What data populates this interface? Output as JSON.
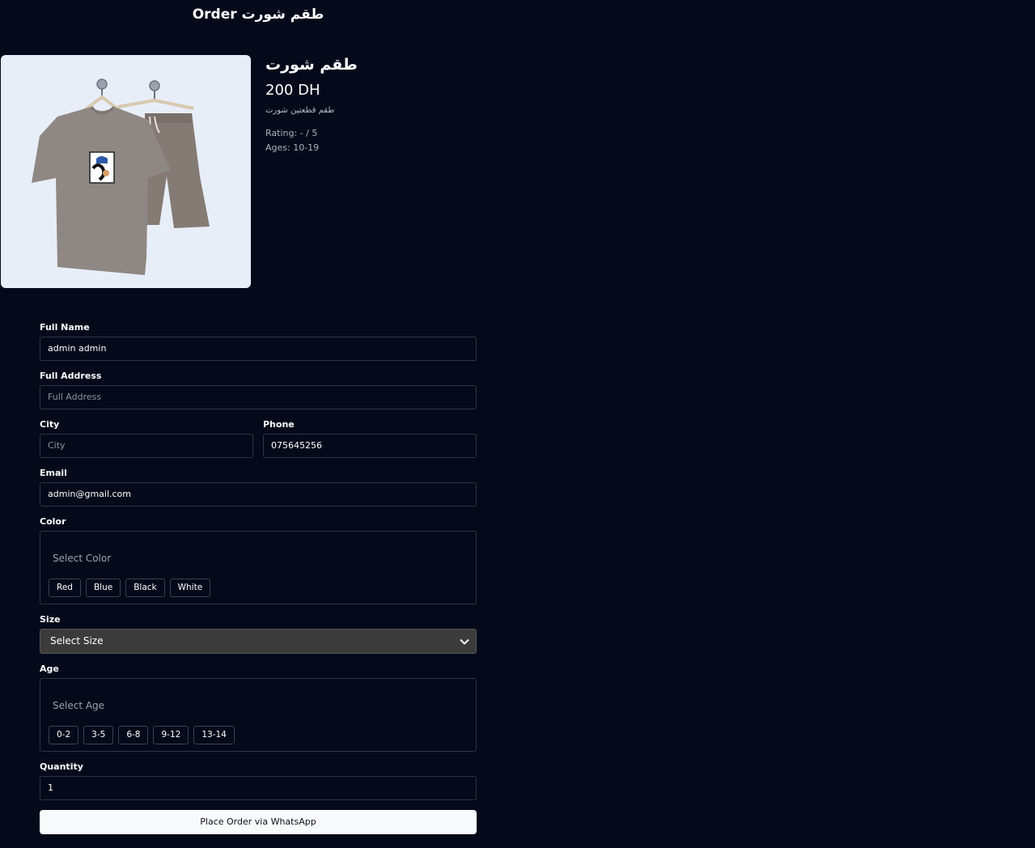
{
  "page": {
    "title": "Order طقم شورت"
  },
  "product": {
    "name": "طقم شورت",
    "price": "200 DH",
    "description": "طقم قطعتين شورت",
    "rating": "Rating: - / 5",
    "ages": "Ages: 10-19",
    "image_icon": "tshirt-shorts-set-on-hanger"
  },
  "form": {
    "full_name": {
      "label": "Full Name",
      "value": "admin admin"
    },
    "full_address": {
      "label": "Full Address",
      "placeholder": "Full Address"
    },
    "city": {
      "label": "City",
      "placeholder": "City"
    },
    "phone": {
      "label": "Phone",
      "value": "075645256"
    },
    "email": {
      "label": "Email",
      "value": "admin@gmail.com"
    },
    "color": {
      "label": "Color",
      "placeholder": "Select Color",
      "options": [
        "Red",
        "Blue",
        "Black",
        "White"
      ]
    },
    "size": {
      "label": "Size",
      "selected": "Select Size"
    },
    "age": {
      "label": "Age",
      "placeholder": "Select Age",
      "options": [
        "0-2",
        "3-5",
        "6-8",
        "9-12",
        "13-14"
      ]
    },
    "quantity": {
      "label": "Quantity",
      "value": "1"
    },
    "submit_label": "Place Order via WhatsApp"
  },
  "colors": {
    "background": "#050a1a",
    "button": "#f8fafc",
    "select_bg": "#3b3b3b",
    "image_bg": "#e8eef8"
  }
}
